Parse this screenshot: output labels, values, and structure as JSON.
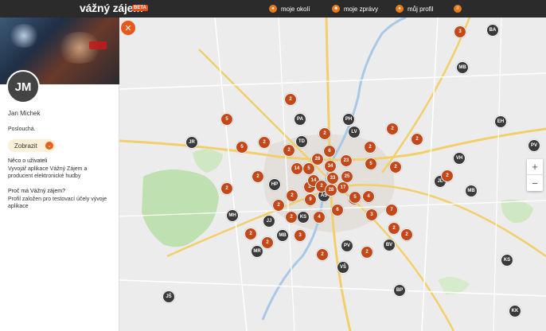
{
  "app": {
    "logo": "vážný zájem",
    "beta": "BETA"
  },
  "nav": [
    {
      "label": "moje okolí",
      "icon": "pin-icon"
    },
    {
      "label": "moje zprávy",
      "icon": "message-icon"
    },
    {
      "label": "můj profil",
      "icon": "profile-icon"
    },
    {
      "label": "",
      "icon": "menu-icon"
    }
  ],
  "profile": {
    "initials": "JM",
    "name": "Jan Michek",
    "status": "Poslouchá.",
    "show_label": "Zobrazit",
    "about_heading": "Něco o uživateli",
    "about_text": "Vyvojář aplikace Vážný Zájem a producent elektronické hudby",
    "why_heading": "Proč má Vážný zájem?",
    "why_text": "Profil založen pro testovací účely vývoje aplikace"
  },
  "map": {
    "zoom_in": "+",
    "zoom_out": "−",
    "close": "✕",
    "user_pins": [
      "BA",
      "MB",
      "EH",
      "PV",
      "JR",
      "PA",
      "PH",
      "LV",
      "TD",
      "VH",
      "JL",
      "MB",
      "HP",
      "AS",
      "KS",
      "MH",
      "JJ",
      "MB",
      "MR",
      "PV",
      "BV",
      "VŠ",
      "KS",
      "BP",
      "JŠ",
      "KK"
    ],
    "clusters": [
      "3",
      "2",
      "5",
      "2",
      "5",
      "2",
      "2",
      "2",
      "2",
      "2",
      "2",
      "28",
      "6",
      "5",
      "14",
      "23",
      "5",
      "2",
      "2",
      "34",
      "33",
      "25",
      "2",
      "2",
      "2",
      "14",
      "2",
      "28",
      "17",
      "4",
      "2",
      "2",
      "9",
      "2",
      "6",
      "5",
      "4",
      "7",
      "3",
      "2",
      "2",
      "3",
      "2",
      "2",
      "2",
      "2"
    ]
  }
}
